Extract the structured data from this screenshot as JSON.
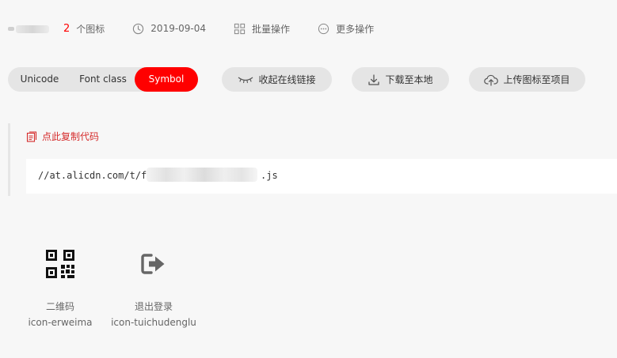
{
  "info": {
    "project_name": "",
    "icon_count": "2",
    "icon_count_label": "个图标",
    "date": "2019-09-04",
    "batch_label": "批量操作",
    "more_label": "更多操作"
  },
  "tabs": [
    {
      "label": "Unicode",
      "active": false
    },
    {
      "label": "Font class",
      "active": false
    },
    {
      "label": "Symbol",
      "active": true
    }
  ],
  "actions": {
    "collapse_label": "收起在线链接",
    "download_label": "下载至本地",
    "upload_label": "上传图标至项目"
  },
  "code": {
    "copy_label": "点此复制代码",
    "url_prefix": "//at.alicdn.com/t/fo",
    "url_suffix": ".js"
  },
  "icons": [
    {
      "name": "二维码",
      "code": "icon-erweima",
      "glyph": "qr-code-icon"
    },
    {
      "name": "退出登录",
      "code": "icon-tuichudenglu",
      "glyph": "logout-icon"
    }
  ],
  "colors": {
    "accent": "#ff0000",
    "copy_link": "#d52b2b",
    "background": "#f7f7f7",
    "pill": "#e5e5e5"
  }
}
